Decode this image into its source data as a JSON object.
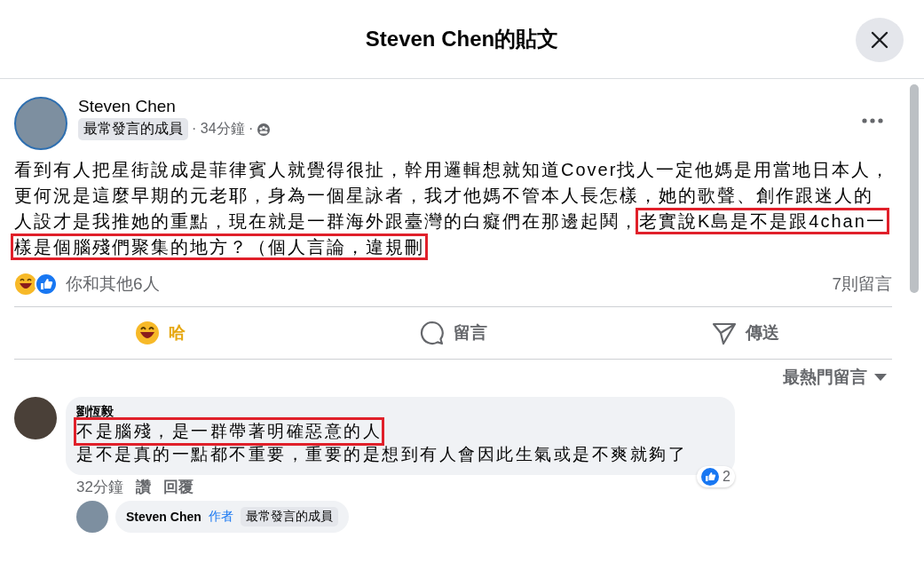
{
  "dialog": {
    "title": "Steven Chen的貼文"
  },
  "post": {
    "author": "Steven Chen",
    "badge": "最常發言的成員",
    "time": "· 34分鐘 ·",
    "body": [
      {
        "text": "看到有人把星街說成是菲律賓人就覺得很扯，幹用邏輯想就知道Cover找人一定他媽是用當地日本人，更何況是這麼早期的元老耶，身為一個星詠者，我才他媽不管本人長怎樣，她的歌聲、創作跟迷人的人設才是我推她的重點，現在就是一群海外跟臺灣的白癡們在那邊起鬨，",
        "highlighted": false
      },
      {
        "text": "老實說K島是不是跟4chan一樣是個腦殘們聚集的地方？（個人言論，違規刪",
        "highlighted": true
      }
    ],
    "reactions_summary": "你和其他6人",
    "comment_count": "7則留言"
  },
  "actions": [
    {
      "label": "哈",
      "kind": "reaction",
      "selected": true
    },
    {
      "label": "留言",
      "kind": "comment",
      "selected": false
    },
    {
      "label": "傳送",
      "kind": "send",
      "selected": false
    }
  ],
  "sort": {
    "label": "最熱門留言"
  },
  "comments": [
    {
      "author": "劉恆毅",
      "lines": [
        {
          "text": "不是腦殘，是一群帶著明確惡意的人",
          "highlighted": true
        },
        {
          "text": "是不是真的一點都不重要，重要的是想到有人會因此生氣或是不爽就夠了",
          "highlighted": false
        }
      ],
      "likes": "2",
      "time": "32分鐘",
      "like_label": "讚",
      "reply_label": "回覆",
      "replies": [
        {
          "author": "Steven Chen",
          "role": "作者",
          "badge": "最常發言的成員"
        }
      ]
    }
  ]
}
